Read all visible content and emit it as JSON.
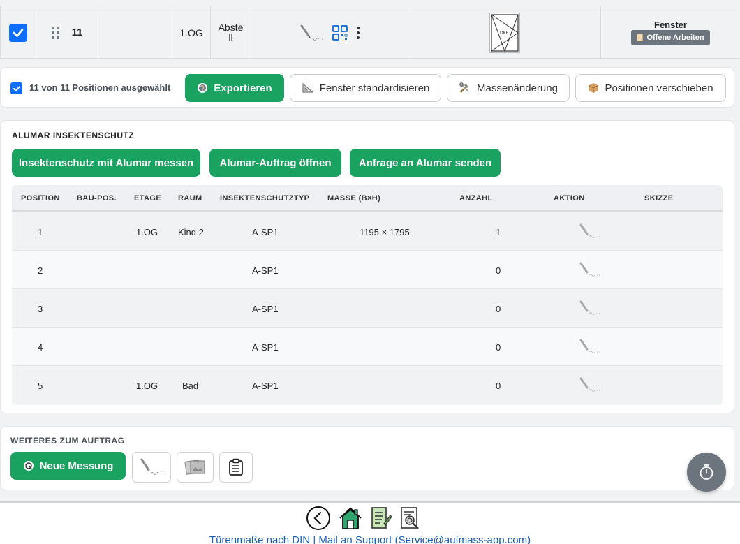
{
  "top_row": {
    "position_number": "11",
    "etage": "1.OG",
    "raum": "Abstell",
    "type_label": "Fenster",
    "thumb_label": "DKR",
    "open_work_label": "Offene Arbeiten"
  },
  "selection": {
    "text": "11 von 11 Positionen ausgewählt",
    "export_label": "Exportieren",
    "standardize_label": "Fenster standardisieren",
    "mass_change_label": "Massenänderung",
    "move_label": "Positionen verschieben"
  },
  "alumar": {
    "title": "ALUMAR INSEKTENSCHUTZ",
    "measure_label": "Insektenschutz mit Alumar messen",
    "open_order_label": "Alumar-Auftrag öffnen",
    "send_request_label": "Anfrage an Alumar senden",
    "columns": [
      "POSITION",
      "BAU-POS.",
      "ETAGE",
      "RAUM",
      "INSEKTENSCHUTZTYP",
      "MASSE (B×H)",
      "ANZAHL",
      "AKTION",
      "SKIZZE"
    ],
    "rows": [
      {
        "position": "1",
        "bau_pos": "",
        "etage": "1.OG",
        "raum": "Kind 2",
        "typ": "A-SP1",
        "masse": "1195 × 1795",
        "anzahl": "1"
      },
      {
        "position": "2",
        "bau_pos": "",
        "etage": "",
        "raum": "",
        "typ": "A-SP1",
        "masse": "",
        "anzahl": "0"
      },
      {
        "position": "3",
        "bau_pos": "",
        "etage": "",
        "raum": "",
        "typ": "A-SP1",
        "masse": "",
        "anzahl": "0"
      },
      {
        "position": "4",
        "bau_pos": "",
        "etage": "",
        "raum": "",
        "typ": "A-SP1",
        "masse": "",
        "anzahl": "0"
      },
      {
        "position": "5",
        "bau_pos": "",
        "etage": "1.OG",
        "raum": "Bad",
        "typ": "A-SP1",
        "masse": "",
        "anzahl": "0"
      }
    ]
  },
  "further": {
    "title": "WEITERES ZUM AUFTRAG",
    "new_measure_label": "Neue Messung"
  },
  "footer": {
    "din_link": "Türenmaße nach DIN",
    "separator": "|",
    "support_link": "Mail an Support (Service@aufmass-app.com)"
  },
  "colors": {
    "primary_green": "#1aa260",
    "checkbox_blue": "#0d6efd",
    "badge_gray": "#6c757d",
    "link_blue": "#1a5fb4"
  }
}
